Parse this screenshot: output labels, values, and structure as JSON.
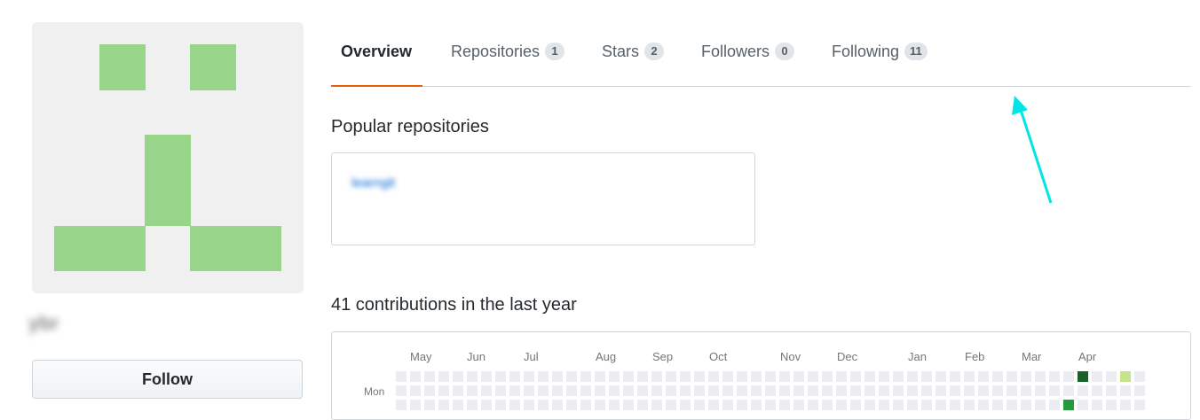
{
  "profile": {
    "username": "ybr",
    "follow_label": "Follow"
  },
  "tabs": [
    {
      "label": "Overview",
      "count": null
    },
    {
      "label": "Repositories",
      "count": "1"
    },
    {
      "label": "Stars",
      "count": "2"
    },
    {
      "label": "Followers",
      "count": "0"
    },
    {
      "label": "Following",
      "count": "11"
    }
  ],
  "popular": {
    "title": "Popular repositories",
    "repos": [
      {
        "name": "learngit"
      }
    ]
  },
  "contributions": {
    "title": "41 contributions in the last year",
    "months": [
      "May",
      "Jun",
      "Jul",
      "Aug",
      "Sep",
      "Oct",
      "Nov",
      "Dec",
      "Jan",
      "Feb",
      "Mar",
      "Apr"
    ],
    "day_label": "Mon",
    "colors": {
      "empty": "#ebedf0",
      "level1": "#c6e48b",
      "level2": "#7bc96f",
      "level3": "#239a3b",
      "level4": "#196127"
    }
  },
  "annotation": {
    "color": "#00e5e5",
    "icon": "arrow-annotation"
  }
}
